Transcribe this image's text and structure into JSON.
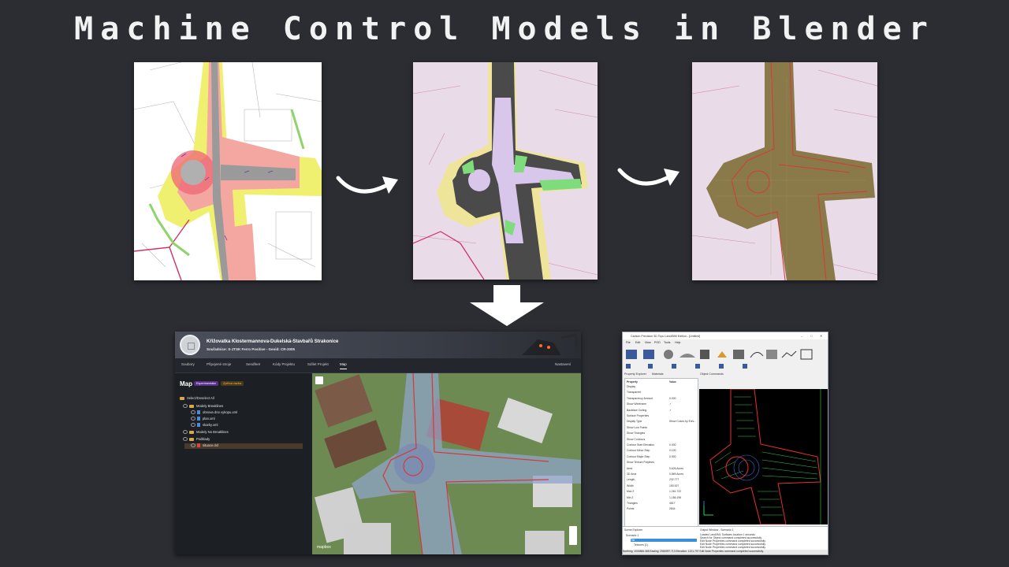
{
  "title": "Machine Control Models in Blender",
  "webapp": {
    "project_title": "Křižovatka Klostermannova-Dukelská-Stavbařů Strakonice",
    "project_sub": "Souřadnice: S-JTSK Ferro Positive - Geoid: CR-2005",
    "nav": [
      "Soubory",
      "Připojené stroje",
      "Sendfeet",
      "Kódy Projektu",
      "Sdílet Projekt",
      "Map",
      "Nastavení"
    ],
    "map_heading": "Map",
    "badges": [
      "Experimentální",
      "Zpětná vazba"
    ],
    "select_all": "Select/Deselect All",
    "tree": [
      {
        "label": "Modely Breaklines",
        "kind": "folder"
      },
      {
        "label": "obnova dno vykopu.xml",
        "kind": "file"
      },
      {
        "label": "plan.xml",
        "kind": "file"
      },
      {
        "label": "skarky.xml",
        "kind": "file"
      },
      {
        "label": "Modely No Breaklines",
        "kind": "folder"
      },
      {
        "label": "Podklady",
        "kind": "folder"
      },
      {
        "label": "situace.dxf",
        "kind": "file-red"
      }
    ],
    "map_attribution": "mapbox"
  },
  "desktop": {
    "window_title": "Carlson Precision 3D Topo Land/BIM Edition - [Untitled]",
    "menu": [
      "File",
      "Edit",
      "View",
      "POD",
      "Tools",
      "Help"
    ],
    "tabs": [
      "Property Explorer",
      "Materials"
    ],
    "object_commands": "Object Commands",
    "prop_header": [
      "Property",
      "Value"
    ],
    "props": [
      {
        "k": "Display",
        "v": ""
      },
      {
        "k": "Transparent",
        "v": ""
      },
      {
        "k": "Transparency Amount",
        "v": "0.000"
      },
      {
        "k": "Show Wireframe",
        "v": "✓"
      },
      {
        "k": "Backface Culling",
        "v": "✓"
      },
      {
        "k": "Surface Properties",
        "v": ""
      },
      {
        "k": "Display Type",
        "v": "Show Colors by Elev..."
      },
      {
        "k": "Show Low Points",
        "v": ""
      },
      {
        "k": "Show Triangles",
        "v": ""
      },
      {
        "k": "Show Contours",
        "v": ""
      },
      {
        "k": "Contour Start Elevation",
        "v": "0.000"
      },
      {
        "k": "Contour Minor Step",
        "v": "0.100"
      },
      {
        "k": "Contour Major Step",
        "v": "0.500"
      },
      {
        "k": "Show Texture Polylines",
        "v": ""
      },
      {
        "k": "Area",
        "v": "0.626 Acres"
      },
      {
        "k": "3D Area",
        "v": "0.869 Acres"
      },
      {
        "k": "Length",
        "v": "232.777"
      },
      {
        "k": "Width",
        "v": "150.007"
      },
      {
        "k": "Max Z",
        "v": "1,261.722"
      },
      {
        "k": "Min Z",
        "v": "1,186.196"
      },
      {
        "k": "Triangles",
        "v": "4617"
      },
      {
        "k": "Points",
        "v": "2844"
      }
    ],
    "scene_explorer": "Scene Explorer",
    "scene_items": [
      "Scenario 1",
      "Tile",
      "Textures (1)"
    ],
    "output_title": "Output Window - Scenario 1",
    "output_lines": [
      "Loaded LandXML Surfaces location 1 seconds",
      "Search for Object command completed successfully.",
      "Edit Node Properties command completed successfully.",
      "Edit Node Properties command completed successfully.",
      "Edit Node Properties command completed successfully."
    ],
    "status": "Northing: 1004884.366  Easting: 2984997.713  Elevation: 1221.797    Edit Node Properties command completed successfully."
  }
}
